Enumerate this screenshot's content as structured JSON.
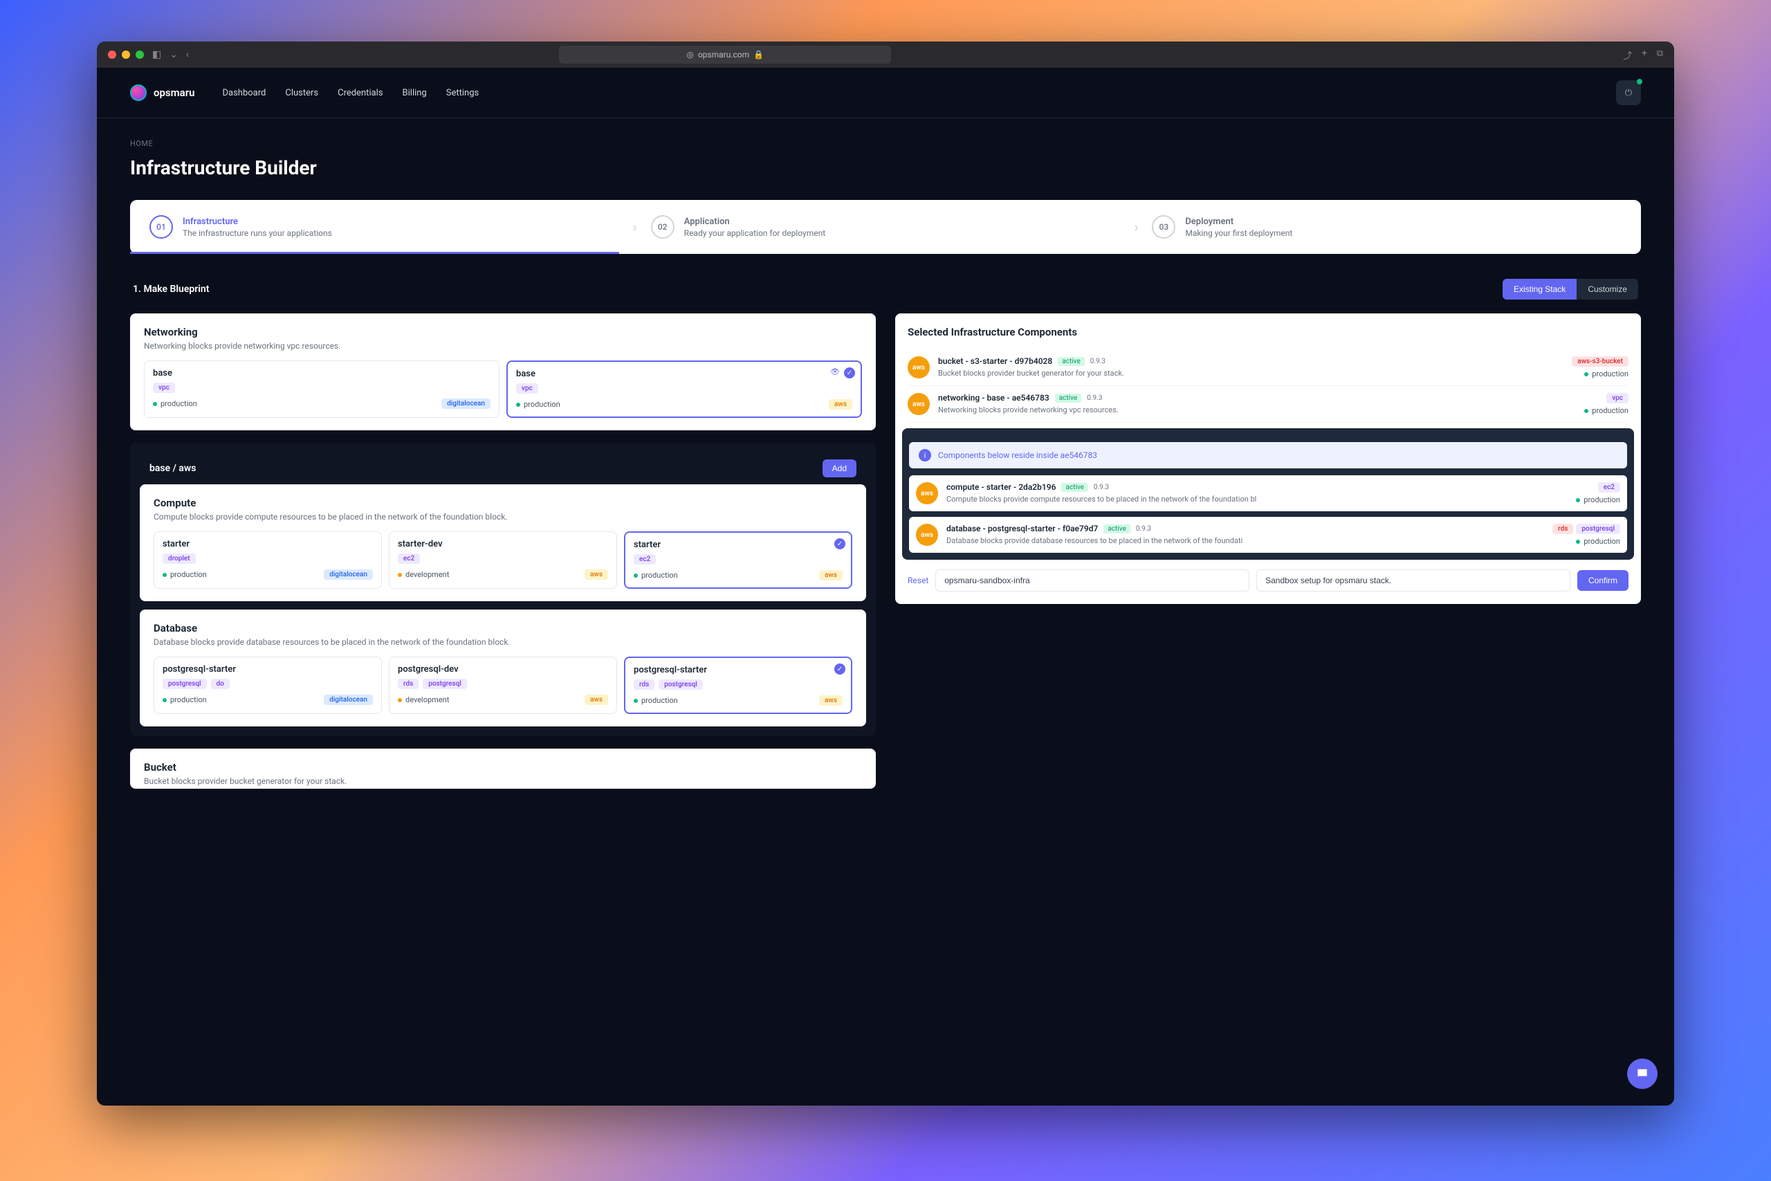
{
  "browser": {
    "url": "opsmaru.com"
  },
  "nav": {
    "brand": "opsmaru",
    "links": [
      "Dashboard",
      "Clusters",
      "Credentials",
      "Billing",
      "Settings"
    ]
  },
  "breadcrumb": "HOME",
  "page_title": "Infrastructure Builder",
  "steps": [
    {
      "num": "01",
      "title": "Infrastructure",
      "desc": "The infrastructure runs your applications"
    },
    {
      "num": "02",
      "title": "Application",
      "desc": "Ready your application for deployment"
    },
    {
      "num": "03",
      "title": "Deployment",
      "desc": "Making your first deployment"
    }
  ],
  "blueprint": {
    "label": "1. Make Blueprint",
    "toggle": {
      "a": "Existing Stack",
      "b": "Customize"
    }
  },
  "networking": {
    "title": "Networking",
    "desc": "Networking blocks provide networking vpc resources.",
    "blocks": [
      {
        "name": "base",
        "tags": [
          "vpc"
        ],
        "env": "production",
        "provider": "digitalocean",
        "provider_class": "blue"
      },
      {
        "name": "base",
        "tags": [
          "vpc"
        ],
        "env": "production",
        "provider": "aws",
        "provider_class": "orange",
        "selected": true,
        "eye": true
      }
    ]
  },
  "base_aws": {
    "title": "base / aws",
    "add": "Add"
  },
  "compute": {
    "title": "Compute",
    "desc": "Compute blocks provide compute resources to be placed in the network of the foundation block.",
    "blocks": [
      {
        "name": "starter",
        "tags": [
          "droplet"
        ],
        "env": "production",
        "provider": "digitalocean",
        "provider_class": "blue"
      },
      {
        "name": "starter-dev",
        "tags": [
          "ec2"
        ],
        "env": "development",
        "env_dot": "amber",
        "provider": "aws",
        "provider_class": "orange"
      },
      {
        "name": "starter",
        "tags": [
          "ec2"
        ],
        "env": "production",
        "provider": "aws",
        "provider_class": "orange",
        "selected": true
      }
    ]
  },
  "database": {
    "title": "Database",
    "desc": "Database blocks provide database resources to be placed in the network of the foundation block.",
    "blocks": [
      {
        "name": "postgresql-starter",
        "tags": [
          "postgresql",
          "do"
        ],
        "env": "production",
        "provider": "digitalocean",
        "provider_class": "blue"
      },
      {
        "name": "postgresql-dev",
        "tags": [
          "rds",
          "postgresql"
        ],
        "env": "development",
        "env_dot": "amber",
        "provider": "aws",
        "provider_class": "orange"
      },
      {
        "name": "postgresql-starter",
        "tags": [
          "rds",
          "postgresql"
        ],
        "env": "production",
        "provider": "aws",
        "provider_class": "orange",
        "selected": true
      }
    ]
  },
  "bucket": {
    "title": "Bucket",
    "desc": "Bucket blocks provider bucket generator for your stack."
  },
  "selected": {
    "title": "Selected Infrastructure Components",
    "items_top": [
      {
        "prov": "aws",
        "name": "bucket - s3-starter - d97b4028",
        "status": "active",
        "ver": "0.9.3",
        "desc": "Bucket blocks provider bucket generator for your stack.",
        "right_tag": "aws-s3-bucket",
        "right_tag_class": "red",
        "env": "production"
      },
      {
        "prov": "aws",
        "name": "networking - base - ae546783",
        "status": "active",
        "ver": "0.9.3",
        "desc": "Networking blocks provide networking vpc resources.",
        "right_tag": "vpc",
        "right_tag_class": "purple",
        "env": "production"
      }
    ],
    "banner": "Components below reside inside ae546783",
    "items_nested": [
      {
        "prov": "aws",
        "name": "compute - starter - 2da2b196",
        "status": "active",
        "ver": "0.9.3",
        "desc": "Compute blocks provide compute resources to be placed in the network of the foundation bl",
        "right_tag": "ec2",
        "right_tag_class": "purple",
        "env": "production"
      },
      {
        "prov": "aws",
        "name": "database - postgresql-starter - f0ae79d7",
        "status": "active",
        "ver": "0.9.3",
        "desc": "Database blocks provide database resources to be placed in the network of the foundati",
        "right_tags": [
          "rds",
          "postgresql"
        ],
        "env": "production"
      }
    ]
  },
  "actions": {
    "reset": "Reset",
    "name_input": "opsmaru-sandbox-infra",
    "desc_input": "Sandbox setup for opsmaru stack.",
    "confirm": "Confirm"
  }
}
